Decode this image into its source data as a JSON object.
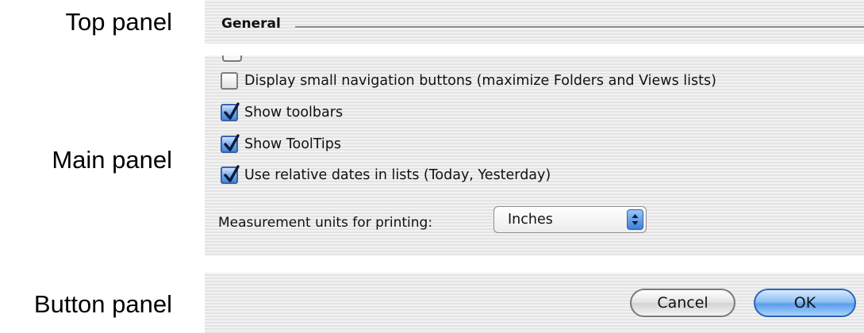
{
  "labels": {
    "top_panel": "Top panel",
    "main_panel": "Main panel",
    "button_panel": "Button panel"
  },
  "group": {
    "title": "General"
  },
  "checkboxes": [
    {
      "label": "Display small navigation buttons (maximize Folders and Views lists)",
      "checked": false
    },
    {
      "label": "Show toolbars",
      "checked": true
    },
    {
      "label": "Show ToolTips",
      "checked": true
    },
    {
      "label": "Use relative dates in lists (Today, Yesterday)",
      "checked": true
    }
  ],
  "measurement": {
    "label": "Measurement units for printing:",
    "selected": "Inches"
  },
  "buttons": {
    "cancel": "Cancel",
    "ok": "OK"
  },
  "colors": {
    "accent": "#5c9ceb",
    "panel": "#ebebeb"
  }
}
